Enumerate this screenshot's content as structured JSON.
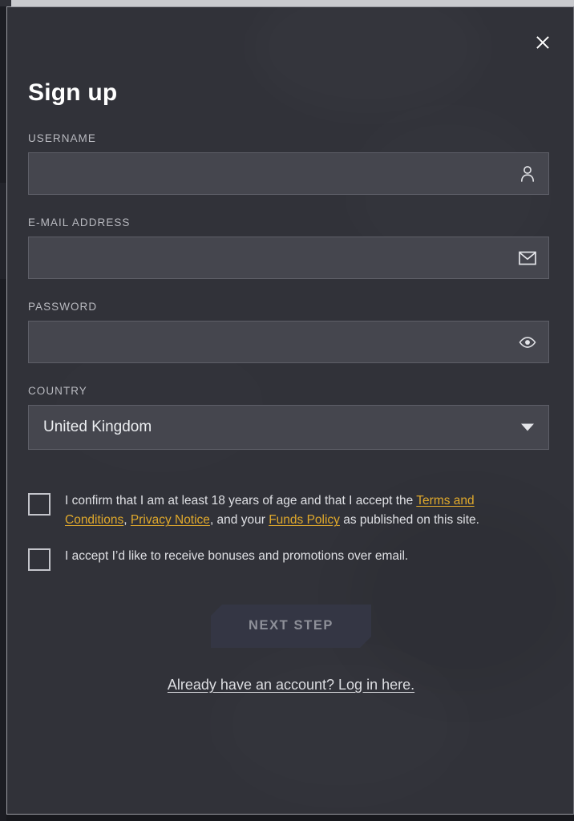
{
  "modal": {
    "title": "Sign up",
    "close_icon": "close-icon"
  },
  "fields": {
    "username": {
      "label": "USERNAME",
      "value": "",
      "placeholder": "",
      "icon": "person-icon"
    },
    "email": {
      "label": "E-MAIL ADDRESS",
      "value": "",
      "placeholder": "",
      "icon": "envelope-icon"
    },
    "password": {
      "label": "PASSWORD",
      "value": "",
      "placeholder": "",
      "icon": "eye-icon"
    },
    "country": {
      "label": "COUNTRY",
      "value": "United Kingdom",
      "icon": "chevron-down-icon"
    }
  },
  "consents": {
    "age_terms": {
      "checked": false,
      "text_part_1": "I confirm that I am at least 18 years of age and that I accept the ",
      "link_terms": "Terms and Conditions",
      "text_part_2": ", ",
      "link_privacy": "Privacy Notice",
      "text_part_3": ", and your ",
      "link_funds": "Funds Policy",
      "text_part_4": " as published on this site."
    },
    "marketing": {
      "checked": false,
      "text": "I accept I’d like to receive bonuses and promotions over email."
    }
  },
  "actions": {
    "next_step_label": "NEXT STEP",
    "login_link": "Already have an account? Log in here."
  },
  "colors": {
    "modal_background": "#313239",
    "input_background": "#45464e",
    "input_border": "#5e5f68",
    "label_text": "#b9bac0",
    "body_text": "#dfe0e4",
    "link_accent": "#e0a92c",
    "button_background": "#343644",
    "button_text": "#8e9099",
    "title_text": "#ffffff"
  }
}
